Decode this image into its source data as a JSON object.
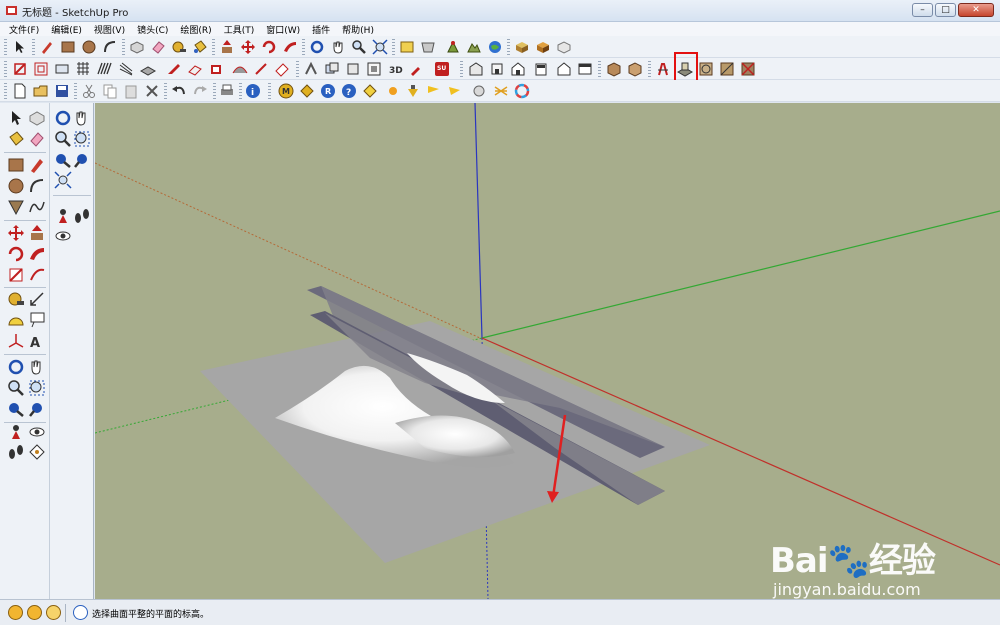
{
  "window": {
    "title": "无标题 - SketchUp Pro",
    "minimize_glyph": "–",
    "maximize_glyph": "□",
    "close_glyph": "✕"
  },
  "menu": [
    {
      "label": "文件(F)"
    },
    {
      "label": "编辑(E)"
    },
    {
      "label": "视图(V)"
    },
    {
      "label": "镜头(C)"
    },
    {
      "label": "绘图(R)"
    },
    {
      "label": "工具(T)"
    },
    {
      "label": "窗口(W)"
    },
    {
      "label": "插件"
    },
    {
      "label": "帮助(H)"
    }
  ],
  "toolbars": {
    "highlighted_tool": "sandbox-stamp-icon",
    "highlight_color": "#e31010"
  },
  "viewport": {
    "background": "#a7ad8c",
    "axis_colors": {
      "red": "#c0302a",
      "green": "#33a833",
      "blue": "#2a35c0"
    }
  },
  "status": {
    "text": "选择曲面平整的平面的标高。"
  },
  "watermark": {
    "logo": "Bai🐾经验",
    "url": "jingyan.baidu.com"
  }
}
